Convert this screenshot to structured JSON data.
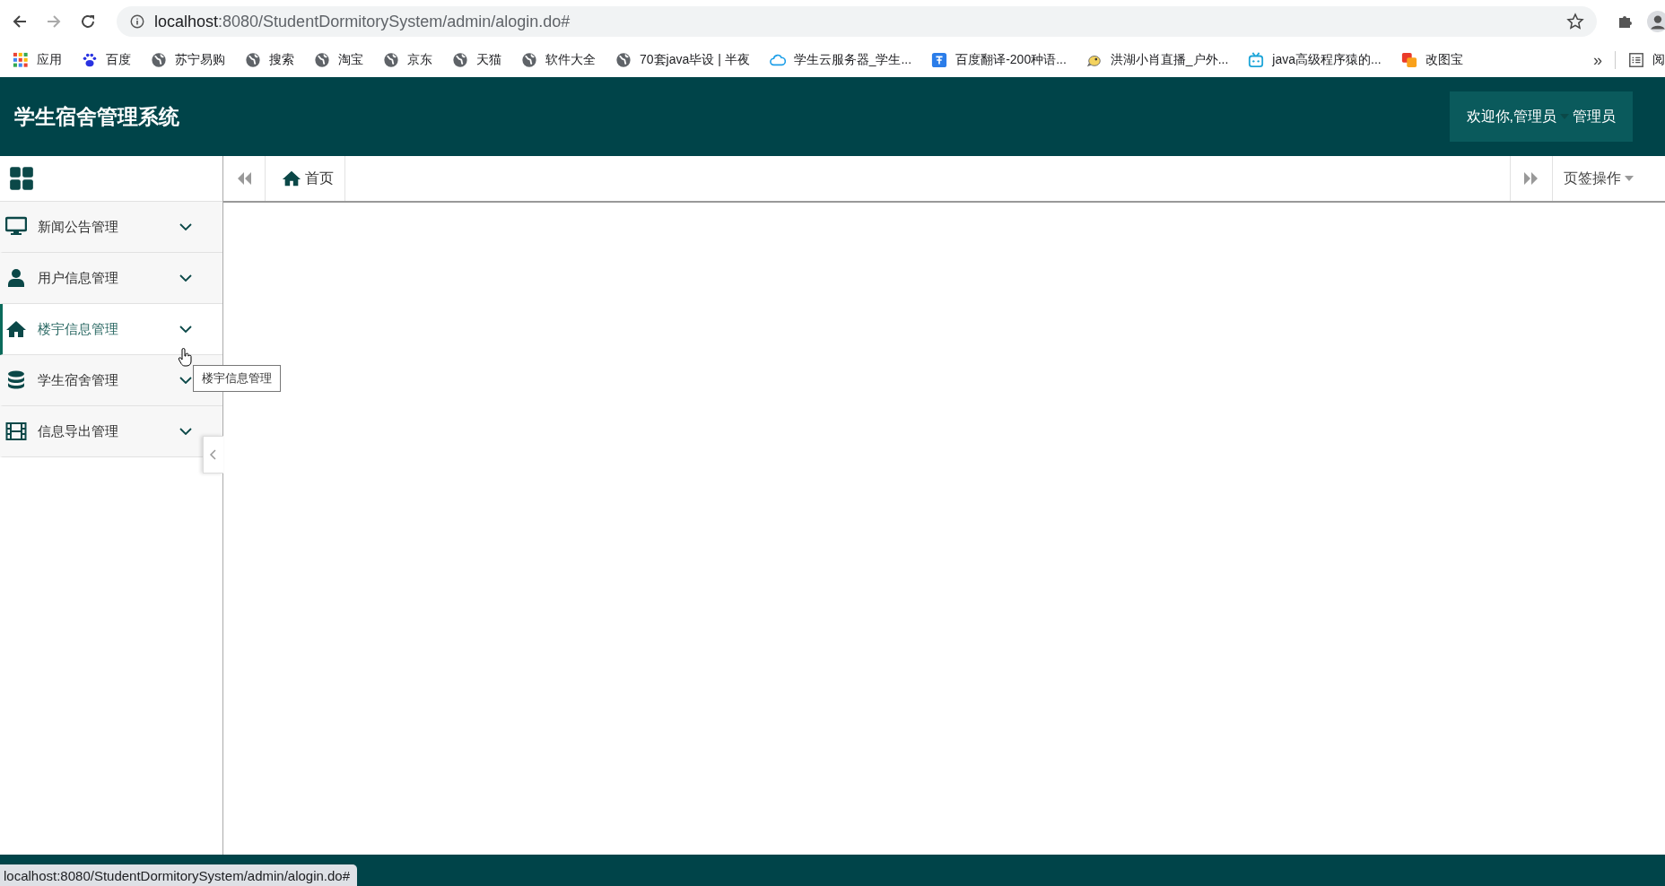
{
  "browser": {
    "url_host": "localhost",
    "url_rest": ":8080/StudentDormitorySystem/admin/alogin.do#",
    "bookmarks": [
      {
        "kind": "apps",
        "label": "应用"
      },
      {
        "kind": "paw",
        "label": "百度"
      },
      {
        "kind": "globe",
        "label": "苏宁易购"
      },
      {
        "kind": "globe",
        "label": "搜索"
      },
      {
        "kind": "globe",
        "label": "淘宝"
      },
      {
        "kind": "globe",
        "label": "京东"
      },
      {
        "kind": "globe",
        "label": "天猫"
      },
      {
        "kind": "globe",
        "label": "软件大全"
      },
      {
        "kind": "globe",
        "label": "70套java毕设 | 半夜"
      },
      {
        "kind": "cloud",
        "label": "学生云服务器_学生..."
      },
      {
        "kind": "translate",
        "label": "百度翻译-200种语..."
      },
      {
        "kind": "bird",
        "label": "洪湖小肖直播_户外..."
      },
      {
        "kind": "tv",
        "label": "java高级程序猿的..."
      },
      {
        "kind": "squares",
        "label": "改图宝"
      }
    ],
    "more": "»",
    "reading_list": "阅"
  },
  "header": {
    "title": "学生宿舍管理系统",
    "greeting": "欢迎你,管理员",
    "user": "管理员"
  },
  "sidebar": {
    "items": [
      {
        "kind": "monitor",
        "label": "新闻公告管理",
        "selected": false
      },
      {
        "kind": "user",
        "label": "用户信息管理",
        "selected": false
      },
      {
        "kind": "home",
        "label": "楼宇信息管理",
        "selected": true
      },
      {
        "kind": "database",
        "label": "学生宿舍管理",
        "selected": false
      },
      {
        "kind": "film",
        "label": "信息导出管理",
        "selected": false
      }
    ]
  },
  "tooltip": "楼宇信息管理",
  "tabs": {
    "items": [
      {
        "label": "首页",
        "selected": true
      }
    ],
    "menu": "页签操作"
  },
  "status_url": "localhost:8080/StudentDormitorySystem/admin/alogin.do#"
}
